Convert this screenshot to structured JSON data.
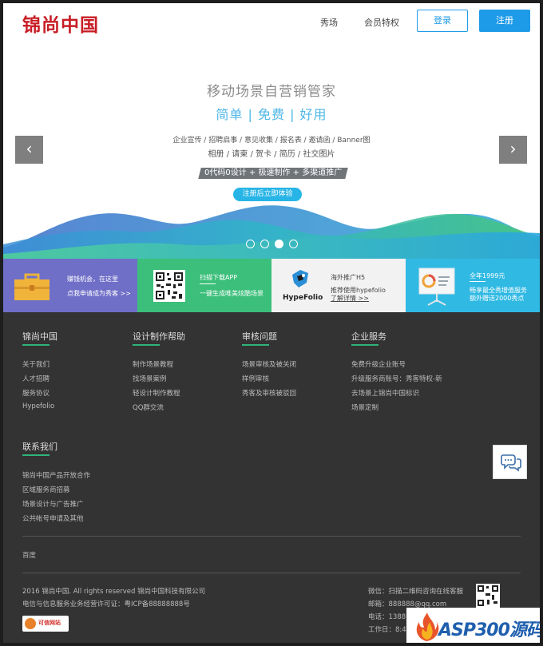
{
  "header": {
    "logo": "锦尚中国",
    "nav": [
      "秀场",
      "会员特权"
    ],
    "login": "登录",
    "register": "注册"
  },
  "hero": {
    "title": "移动场景自营销管家",
    "subtitle": "简单 | 免费 | 好用",
    "line1": "企业宣传 / 招聘启事 / 意见收集 / 报名表 / 邀请函 / Banner图",
    "line2": "相册 / 请柬 / 贺卡 / 简历 / 社交图片",
    "badge": "0代码0设计 + 极速制作 + 多渠道推广",
    "cta": "注册后立即体验",
    "prev": "‹",
    "next": "›",
    "slides": 4,
    "active_slide": 3
  },
  "strip": [
    {
      "line1": "赚钱机会，在这里",
      "line2": "点我申请成为秀客 >>",
      "color": "#6f6fc8",
      "icon": "briefcase-icon"
    },
    {
      "line1": "扫描下载APP",
      "line2": "一键生成唯美炫酷场景",
      "color": "#3bbf7a",
      "icon": "qr-code-icon"
    },
    {
      "line1": "海外推广H5",
      "line2": "推荐使用hypefolio",
      "line3": "了解详情 >>",
      "brand": "HypeFolio",
      "color": "#f2f2f2",
      "icon": "hypefolio-logo-icon"
    },
    {
      "line1": "全年1999元",
      "line2": "畅享最全秀增值服务",
      "line3": "额外赠送2000秀点",
      "color": "#30b9e3",
      "icon": "presentation-board-icon"
    }
  ],
  "footer": {
    "columns": [
      {
        "title": "锦尚中国",
        "links": [
          "关于我们",
          "人才招聘",
          "服务协议",
          "Hypefolio"
        ]
      },
      {
        "title": "设计制作帮助",
        "links": [
          "制作场景教程",
          "找场景案例",
          "轻设计制作教程",
          "QQ群交流"
        ]
      },
      {
        "title": "审核问题",
        "links": [
          "场景审核及被关闭",
          "样例审核",
          "秀客及审核被驳回"
        ]
      },
      {
        "title": "企业服务",
        "links": [
          "免费升级企业账号",
          "升级服务商账号：秀客特权-新",
          "去场景上锦尚中国标识",
          "场景定制"
        ]
      }
    ],
    "contact": {
      "title": "联系我们",
      "links": [
        "锦尚中国产品开放合作",
        "区域服务商招募",
        "场景设计与广告推广",
        "公共帐号申请及其他"
      ]
    },
    "friend_link": "百度",
    "copyright": "2016 锦尚中国. All rights reserved 锦尚中国科技有限公司",
    "icp": "电信与信息服务业务经营许可证：粤ICP备88888888号",
    "cert_badge": "可信网站",
    "service": [
      "微信：扫描二维码咨询在线客服",
      "邮箱：888888@qq.com",
      "电话：1388",
      "工作日：8:4"
    ],
    "watermark": "ASP300源码"
  },
  "colors": {
    "accent": "#1e9be8",
    "logo": "#c81d25",
    "footer_bg": "#333333",
    "footer_accent": "#2fb47a"
  }
}
